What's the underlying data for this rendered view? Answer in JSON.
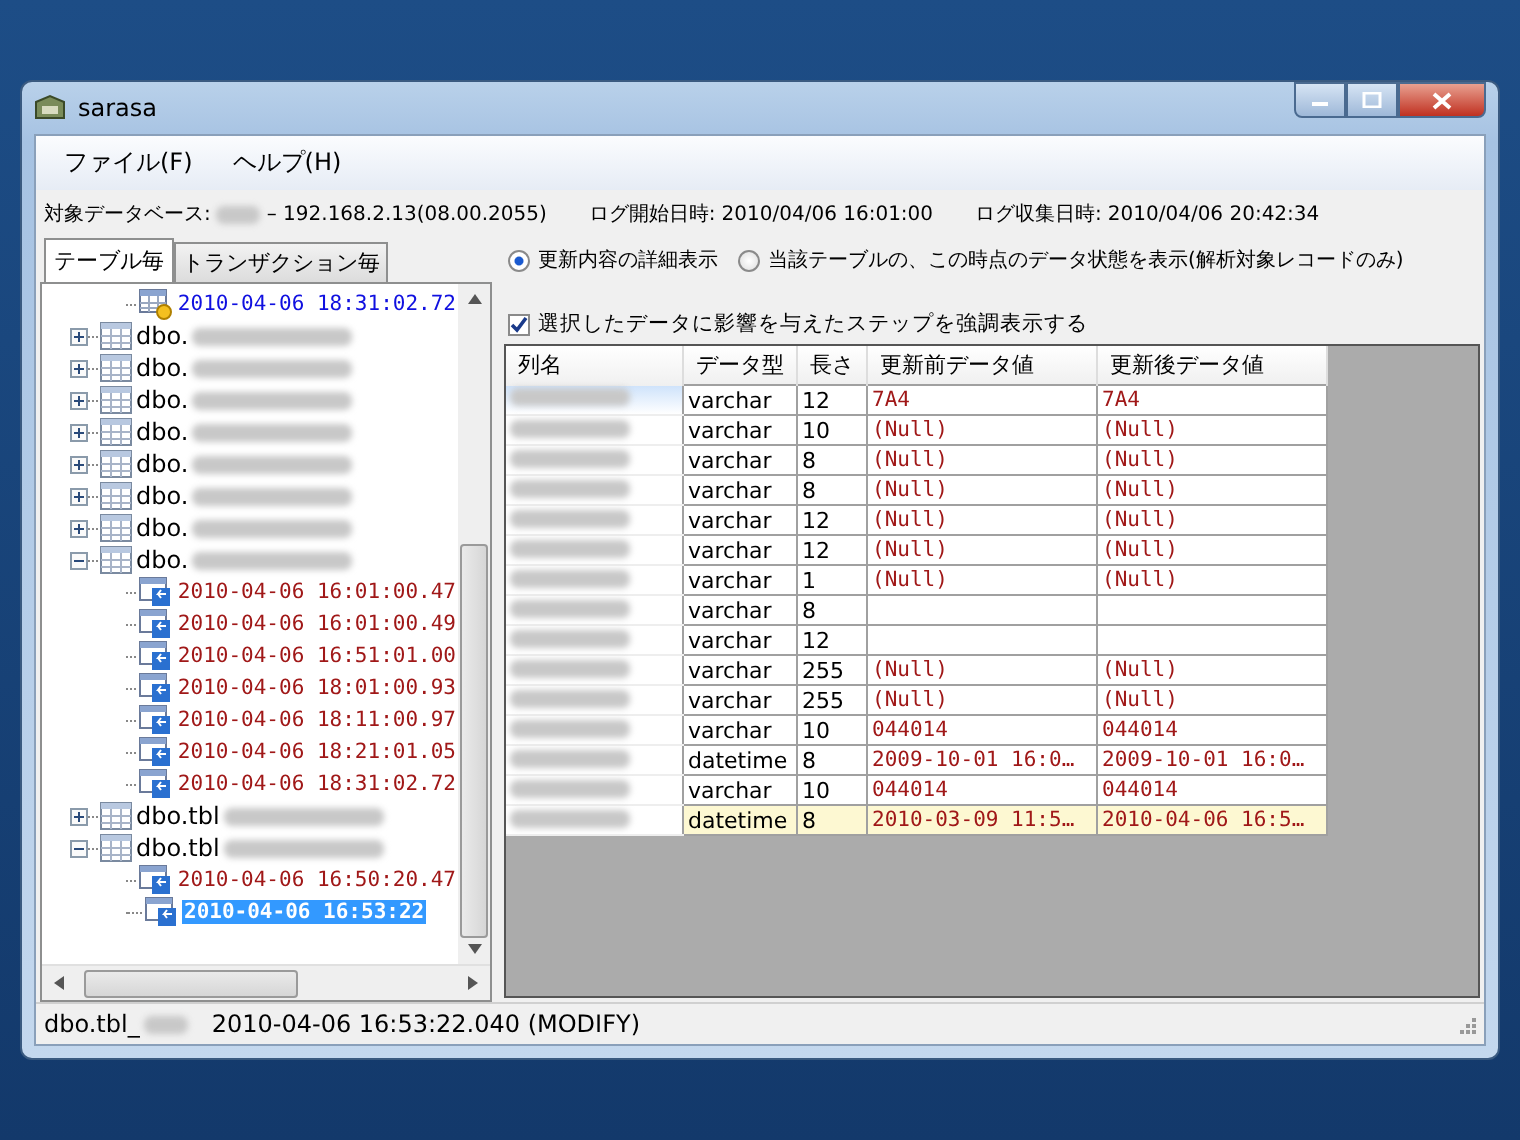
{
  "window": {
    "title": "sarasa"
  },
  "menu": [
    "ファイル(F)",
    "ヘルプ(H)"
  ],
  "info": {
    "database_label": "対象データベース:",
    "database_value": "– 192.168.2.13(08.00.2055)",
    "log_start_label": "ログ開始日時:",
    "log_start": "2010/04/06 16:01:00",
    "log_collect_label": "ログ収集日時:",
    "log_collect": "2010/04/06 20:42:34"
  },
  "tabs": [
    {
      "label": "テーブル毎",
      "selected": true
    },
    {
      "label": "トランザクション毎",
      "selected": false
    }
  ],
  "tree": {
    "leading_children": [
      {
        "label": "2010-04-06 18:31:02.72",
        "kind": "insert",
        "selected": false
      }
    ],
    "tables": [
      {
        "name": "dbo.",
        "expanded": false
      },
      {
        "name": "dbo.",
        "expanded": false
      },
      {
        "name": "dbo.",
        "expanded": false
      },
      {
        "name": "dbo.",
        "expanded": false
      },
      {
        "name": "dbo.",
        "expanded": false
      },
      {
        "name": "dbo.",
        "expanded": false
      },
      {
        "name": "dbo.",
        "expanded": false
      },
      {
        "name": "dbo.",
        "expanded": true,
        "children": [
          {
            "label": "2010-04-06 16:01:00.47",
            "kind": "modify",
            "selected": false
          },
          {
            "label": "2010-04-06 16:01:00.49",
            "kind": "modify",
            "selected": false
          },
          {
            "label": "2010-04-06 16:51:01.00",
            "kind": "modify",
            "selected": false
          },
          {
            "label": "2010-04-06 18:01:00.93",
            "kind": "modify",
            "selected": false
          },
          {
            "label": "2010-04-06 18:11:00.97",
            "kind": "modify",
            "selected": false
          },
          {
            "label": "2010-04-06 18:21:01.05",
            "kind": "modify",
            "selected": false
          },
          {
            "label": "2010-04-06 18:31:02.72",
            "kind": "modify",
            "selected": false
          }
        ]
      },
      {
        "name": "dbo.tbl",
        "expanded": false
      },
      {
        "name": "dbo.tbl",
        "expanded": true,
        "children": [
          {
            "label": "2010-04-06 16:50:20.47",
            "kind": "modify",
            "selected": false
          },
          {
            "label": "2010-04-06 16:53:22",
            "kind": "modify",
            "selected": true
          }
        ]
      }
    ]
  },
  "options": {
    "radios": [
      {
        "label": "更新内容の詳細表示",
        "selected": true
      },
      {
        "label": "当該テーブルの、この時点のデータ状態を表示(解析対象レコードのみ)",
        "selected": false
      }
    ],
    "highlight_checkbox": {
      "label": "選択したデータに影響を与えたステップを強調表示する",
      "checked": true
    }
  },
  "grid": {
    "columns": [
      "列名",
      "データ型",
      "長さ",
      "更新前データ値",
      "更新後データ値"
    ],
    "rows": [
      {
        "type": "varchar",
        "length": "12",
        "before": "7A4",
        "after": "7A4",
        "selected": true,
        "highlighted": false
      },
      {
        "type": "varchar",
        "length": "10",
        "before": "(Null)",
        "after": "(Null)",
        "selected": false,
        "highlighted": false
      },
      {
        "type": "varchar",
        "length": "8",
        "before": "(Null)",
        "after": "(Null)",
        "selected": false,
        "highlighted": false
      },
      {
        "type": "varchar",
        "length": "8",
        "before": "(Null)",
        "after": "(Null)",
        "selected": false,
        "highlighted": false
      },
      {
        "type": "varchar",
        "length": "12",
        "before": "(Null)",
        "after": "(Null)",
        "selected": false,
        "highlighted": false
      },
      {
        "type": "varchar",
        "length": "12",
        "before": "(Null)",
        "after": "(Null)",
        "selected": false,
        "highlighted": false
      },
      {
        "type": "varchar",
        "length": "1",
        "before": "(Null)",
        "after": "(Null)",
        "selected": false,
        "highlighted": false
      },
      {
        "type": "varchar",
        "length": "8",
        "selected": false,
        "highlighted": false
      },
      {
        "type": "varchar",
        "length": "12",
        "selected": false,
        "highlighted": false
      },
      {
        "type": "varchar",
        "length": "255",
        "before": "(Null)",
        "after": "(Null)",
        "selected": false,
        "highlighted": false
      },
      {
        "type": "varchar",
        "length": "255",
        "before": "(Null)",
        "after": "(Null)",
        "selected": false,
        "highlighted": false
      },
      {
        "type": "varchar",
        "length": "10",
        "before": "044014",
        "after": "044014",
        "selected": false,
        "highlighted": false
      },
      {
        "type": "datetime",
        "length": "8",
        "before": "2009-10-01 16:0…",
        "after": "2009-10-01 16:0…",
        "selected": false,
        "highlighted": false
      },
      {
        "type": "varchar",
        "length": "10",
        "before": "044014",
        "after": "044014",
        "selected": false,
        "highlighted": false
      },
      {
        "type": "datetime",
        "length": "8",
        "before": "2010-03-09 11:5…",
        "after": "2010-04-06 16:5…",
        "selected": false,
        "highlighted": true
      }
    ]
  },
  "status_bar": {
    "table_prefix": "dbo.tbl_",
    "event": "2010-04-06 16:53:22.040 (MODIFY)"
  }
}
